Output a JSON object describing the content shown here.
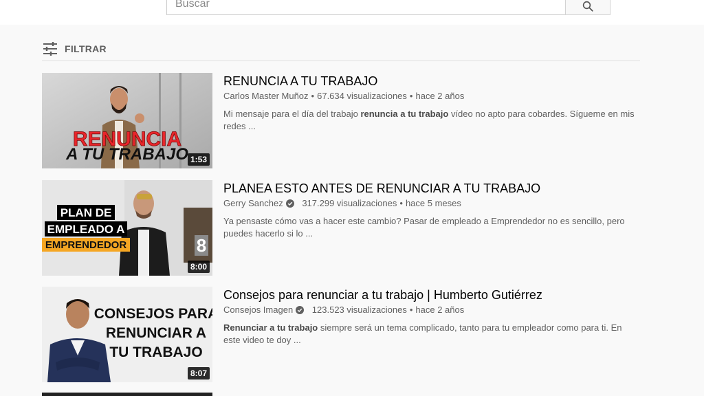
{
  "search": {
    "placeholder": "Buscar"
  },
  "filter": {
    "label": "FILTRAR"
  },
  "results": [
    {
      "title": "RENUNCIA A TU TRABAJO",
      "channel": "Carlos Master Muñoz",
      "verified": false,
      "views": "67.634 visualizaciones",
      "age": "hace 2 años",
      "desc_pre": "Mi mensaje para el día del trabajo ",
      "desc_bold": "renuncia a tu trabajo",
      "desc_post": " vídeo no apto para cobardes. Sígueme en mis redes ...",
      "duration": "1:53",
      "thumb_text": [
        "RENUNCIA",
        "A TU TRABAJO"
      ]
    },
    {
      "title": "PLANEA ESTO ANTES DE RENUNCIAR A TU TRABAJO",
      "channel": "Gerry Sanchez",
      "verified": true,
      "views": "317.299 visualizaciones",
      "age": "hace 5 meses",
      "desc_pre": "Ya pensaste cómo vas a hacer este cambio? Pasar de empleado a Emprendedor no es sencillo, pero puedes hacerlo si lo ...",
      "desc_bold": "",
      "desc_post": "",
      "duration": "8:00",
      "thumb_text": [
        "PLAN DE",
        "EMPLEADO A",
        "EMPRENDEDOR"
      ]
    },
    {
      "title": "Consejos para renunciar a tu trabajo | Humberto Gutiérrez",
      "channel": "Consejos Imagen",
      "verified": true,
      "views": "123.523 visualizaciones",
      "age": "hace 2 años",
      "desc_pre": "",
      "desc_bold": "Renunciar a tu trabajo",
      "desc_post": " siempre será un tema complicado, tanto para tu empleador como para ti. En este video te doy ...",
      "duration": "8:07",
      "thumb_text": [
        "CONSEJOS PARA",
        "RENUNCIAR A",
        "TU TRABAJO"
      ]
    }
  ],
  "colors": {
    "accent_red": "#e8262b",
    "accent_orange": "#f5a623",
    "meta_gray": "#606060"
  },
  "icons": {
    "search": "search-icon",
    "filter": "filter-sliders-icon",
    "verified": "verified-check-icon"
  }
}
